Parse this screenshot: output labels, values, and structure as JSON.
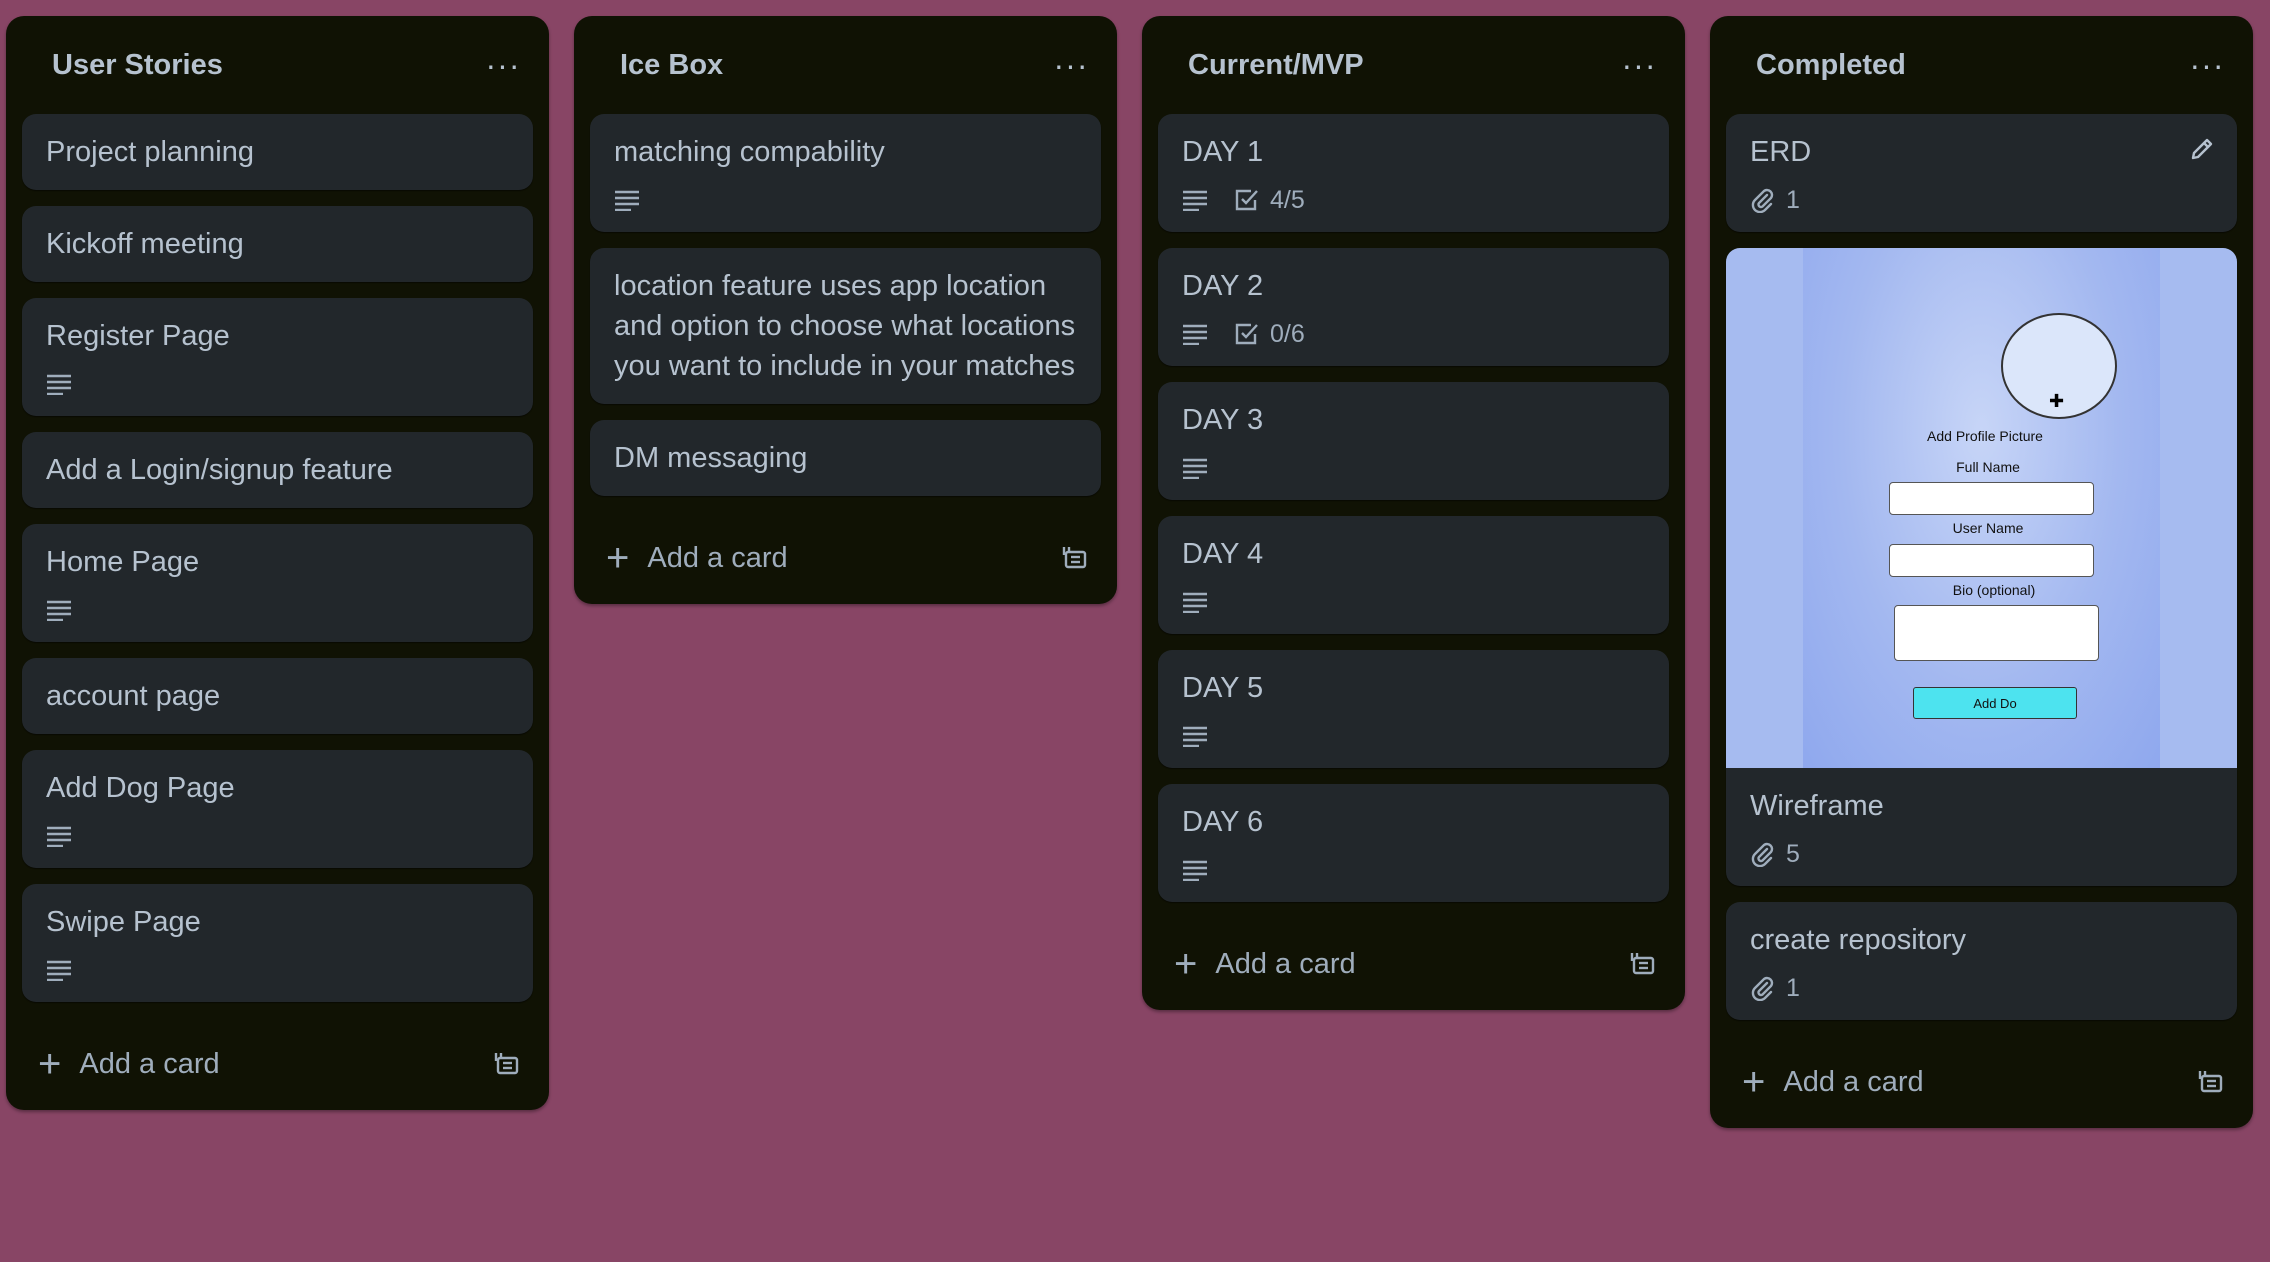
{
  "lists": [
    {
      "title": "User Stories",
      "cards": [
        {
          "title": "Project planning"
        },
        {
          "title": "Kickoff meeting"
        },
        {
          "title": "Register Page"
        },
        {
          "title": "Add a Login/signup feature"
        },
        {
          "title": "Home Page"
        },
        {
          "title": "account page"
        },
        {
          "title": "Add Dog Page"
        },
        {
          "title": "Swipe Page"
        }
      ],
      "add_label": "Add a card"
    },
    {
      "title": "Ice Box",
      "cards": [
        {
          "title": "matching compability"
        },
        {
          "title": "location feature uses app location and option to choose what locations you want to include in your matches"
        },
        {
          "title": "DM messaging"
        }
      ],
      "add_label": "Add a card"
    },
    {
      "title": "Current/MVP",
      "cards": [
        {
          "title": "DAY 1",
          "checklist": "4/5"
        },
        {
          "title": "DAY 2",
          "checklist": "0/6"
        },
        {
          "title": "DAY 3"
        },
        {
          "title": "DAY 4"
        },
        {
          "title": "DAY 5"
        },
        {
          "title": "DAY 6"
        }
      ],
      "add_label": "Add a card"
    },
    {
      "title": "Completed",
      "cards": [
        {
          "title": "ERD",
          "attachments": "1"
        },
        {
          "title": "Wireframe",
          "attachments": "5",
          "cover": {
            "add_profile_picture": "Add Profile Picture",
            "full_name": "Full Name",
            "user_name": "User Name",
            "bio": "Bio (optional)",
            "button": "Add Do"
          }
        },
        {
          "title": "create repository",
          "attachments": "1"
        }
      ],
      "add_label": "Add a card"
    }
  ],
  "menu_glyph": "···",
  "plus_glyph": "+",
  "wireframe_plus_glyph": "✚",
  "icons": {
    "list_menu": "more-horizontal-icon",
    "description": "description-lines-icon",
    "checklist": "checklist-icon",
    "attachment": "paperclip-icon",
    "edit": "pencil-icon",
    "template": "card-template-icon",
    "add": "plus-icon"
  },
  "colors": {
    "board_background": "#884565",
    "list_background": "#101204",
    "card_background": "#22272b",
    "text": "#b6c2cf",
    "muted_text": "#9fadbc"
  }
}
